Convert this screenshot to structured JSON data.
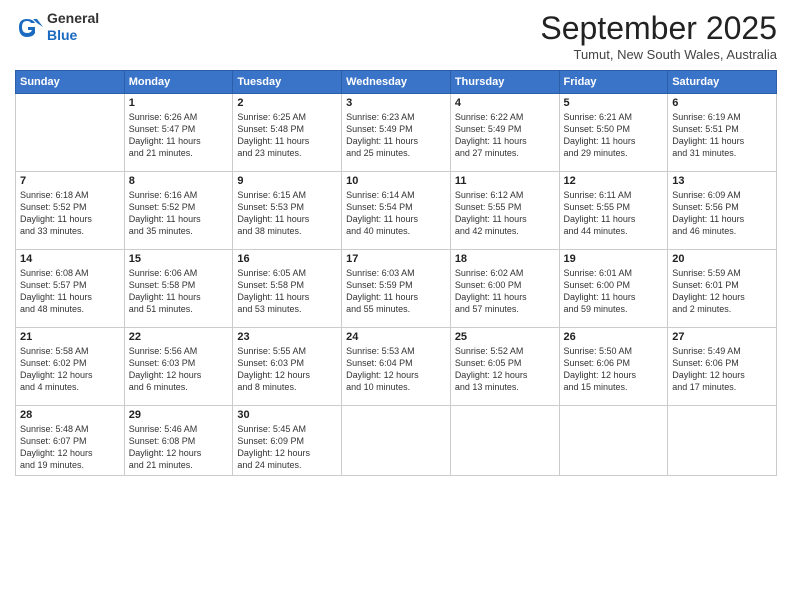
{
  "logo": {
    "general": "General",
    "blue": "Blue"
  },
  "header": {
    "month": "September 2025",
    "location": "Tumut, New South Wales, Australia"
  },
  "days_of_week": [
    "Sunday",
    "Monday",
    "Tuesday",
    "Wednesday",
    "Thursday",
    "Friday",
    "Saturday"
  ],
  "weeks": [
    [
      {
        "day": "",
        "sunrise": "",
        "sunset": "",
        "daylight": ""
      },
      {
        "day": "1",
        "sunrise": "Sunrise: 6:26 AM",
        "sunset": "Sunset: 5:47 PM",
        "daylight": "Daylight: 11 hours and 21 minutes."
      },
      {
        "day": "2",
        "sunrise": "Sunrise: 6:25 AM",
        "sunset": "Sunset: 5:48 PM",
        "daylight": "Daylight: 11 hours and 23 minutes."
      },
      {
        "day": "3",
        "sunrise": "Sunrise: 6:23 AM",
        "sunset": "Sunset: 5:49 PM",
        "daylight": "Daylight: 11 hours and 25 minutes."
      },
      {
        "day": "4",
        "sunrise": "Sunrise: 6:22 AM",
        "sunset": "Sunset: 5:49 PM",
        "daylight": "Daylight: 11 hours and 27 minutes."
      },
      {
        "day": "5",
        "sunrise": "Sunrise: 6:21 AM",
        "sunset": "Sunset: 5:50 PM",
        "daylight": "Daylight: 11 hours and 29 minutes."
      },
      {
        "day": "6",
        "sunrise": "Sunrise: 6:19 AM",
        "sunset": "Sunset: 5:51 PM",
        "daylight": "Daylight: 11 hours and 31 minutes."
      }
    ],
    [
      {
        "day": "7",
        "sunrise": "Sunrise: 6:18 AM",
        "sunset": "Sunset: 5:52 PM",
        "daylight": "Daylight: 11 hours and 33 minutes."
      },
      {
        "day": "8",
        "sunrise": "Sunrise: 6:16 AM",
        "sunset": "Sunset: 5:52 PM",
        "daylight": "Daylight: 11 hours and 35 minutes."
      },
      {
        "day": "9",
        "sunrise": "Sunrise: 6:15 AM",
        "sunset": "Sunset: 5:53 PM",
        "daylight": "Daylight: 11 hours and 38 minutes."
      },
      {
        "day": "10",
        "sunrise": "Sunrise: 6:14 AM",
        "sunset": "Sunset: 5:54 PM",
        "daylight": "Daylight: 11 hours and 40 minutes."
      },
      {
        "day": "11",
        "sunrise": "Sunrise: 6:12 AM",
        "sunset": "Sunset: 5:55 PM",
        "daylight": "Daylight: 11 hours and 42 minutes."
      },
      {
        "day": "12",
        "sunrise": "Sunrise: 6:11 AM",
        "sunset": "Sunset: 5:55 PM",
        "daylight": "Daylight: 11 hours and 44 minutes."
      },
      {
        "day": "13",
        "sunrise": "Sunrise: 6:09 AM",
        "sunset": "Sunset: 5:56 PM",
        "daylight": "Daylight: 11 hours and 46 minutes."
      }
    ],
    [
      {
        "day": "14",
        "sunrise": "Sunrise: 6:08 AM",
        "sunset": "Sunset: 5:57 PM",
        "daylight": "Daylight: 11 hours and 48 minutes."
      },
      {
        "day": "15",
        "sunrise": "Sunrise: 6:06 AM",
        "sunset": "Sunset: 5:58 PM",
        "daylight": "Daylight: 11 hours and 51 minutes."
      },
      {
        "day": "16",
        "sunrise": "Sunrise: 6:05 AM",
        "sunset": "Sunset: 5:58 PM",
        "daylight": "Daylight: 11 hours and 53 minutes."
      },
      {
        "day": "17",
        "sunrise": "Sunrise: 6:03 AM",
        "sunset": "Sunset: 5:59 PM",
        "daylight": "Daylight: 11 hours and 55 minutes."
      },
      {
        "day": "18",
        "sunrise": "Sunrise: 6:02 AM",
        "sunset": "Sunset: 6:00 PM",
        "daylight": "Daylight: 11 hours and 57 minutes."
      },
      {
        "day": "19",
        "sunrise": "Sunrise: 6:01 AM",
        "sunset": "Sunset: 6:00 PM",
        "daylight": "Daylight: 11 hours and 59 minutes."
      },
      {
        "day": "20",
        "sunrise": "Sunrise: 5:59 AM",
        "sunset": "Sunset: 6:01 PM",
        "daylight": "Daylight: 12 hours and 2 minutes."
      }
    ],
    [
      {
        "day": "21",
        "sunrise": "Sunrise: 5:58 AM",
        "sunset": "Sunset: 6:02 PM",
        "daylight": "Daylight: 12 hours and 4 minutes."
      },
      {
        "day": "22",
        "sunrise": "Sunrise: 5:56 AM",
        "sunset": "Sunset: 6:03 PM",
        "daylight": "Daylight: 12 hours and 6 minutes."
      },
      {
        "day": "23",
        "sunrise": "Sunrise: 5:55 AM",
        "sunset": "Sunset: 6:03 PM",
        "daylight": "Daylight: 12 hours and 8 minutes."
      },
      {
        "day": "24",
        "sunrise": "Sunrise: 5:53 AM",
        "sunset": "Sunset: 6:04 PM",
        "daylight": "Daylight: 12 hours and 10 minutes."
      },
      {
        "day": "25",
        "sunrise": "Sunrise: 5:52 AM",
        "sunset": "Sunset: 6:05 PM",
        "daylight": "Daylight: 12 hours and 13 minutes."
      },
      {
        "day": "26",
        "sunrise": "Sunrise: 5:50 AM",
        "sunset": "Sunset: 6:06 PM",
        "daylight": "Daylight: 12 hours and 15 minutes."
      },
      {
        "day": "27",
        "sunrise": "Sunrise: 5:49 AM",
        "sunset": "Sunset: 6:06 PM",
        "daylight": "Daylight: 12 hours and 17 minutes."
      }
    ],
    [
      {
        "day": "28",
        "sunrise": "Sunrise: 5:48 AM",
        "sunset": "Sunset: 6:07 PM",
        "daylight": "Daylight: 12 hours and 19 minutes."
      },
      {
        "day": "29",
        "sunrise": "Sunrise: 5:46 AM",
        "sunset": "Sunset: 6:08 PM",
        "daylight": "Daylight: 12 hours and 21 minutes."
      },
      {
        "day": "30",
        "sunrise": "Sunrise: 5:45 AM",
        "sunset": "Sunset: 6:09 PM",
        "daylight": "Daylight: 12 hours and 24 minutes."
      },
      {
        "day": "",
        "sunrise": "",
        "sunset": "",
        "daylight": ""
      },
      {
        "day": "",
        "sunrise": "",
        "sunset": "",
        "daylight": ""
      },
      {
        "day": "",
        "sunrise": "",
        "sunset": "",
        "daylight": ""
      },
      {
        "day": "",
        "sunrise": "",
        "sunset": "",
        "daylight": ""
      }
    ]
  ]
}
